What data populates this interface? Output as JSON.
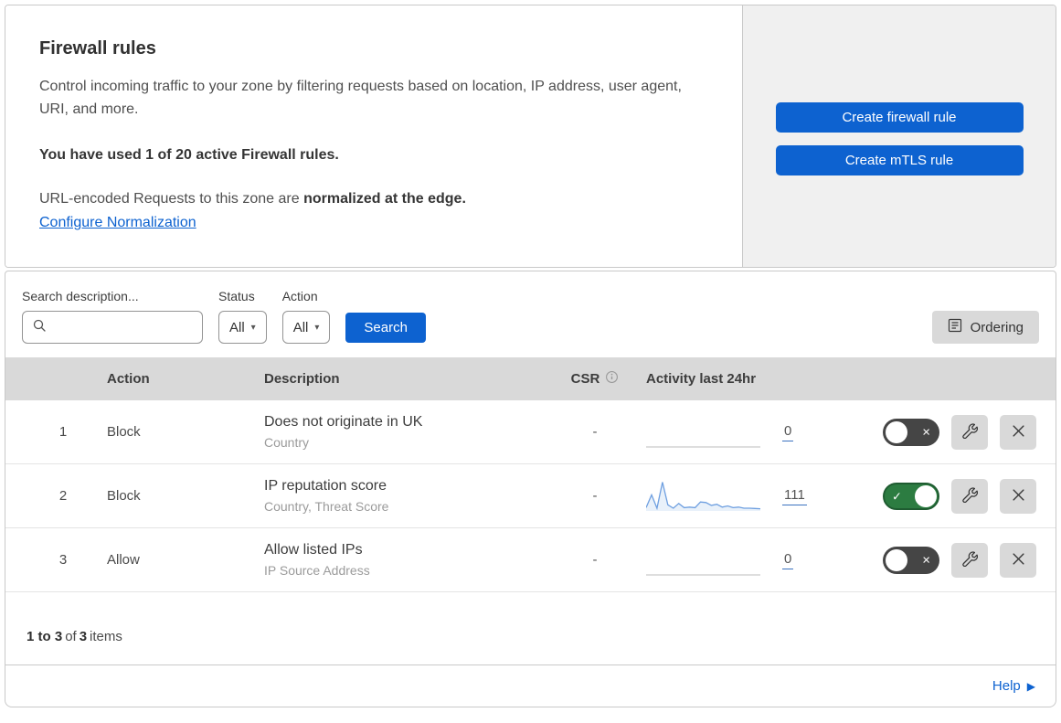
{
  "intro": {
    "title": "Firewall rules",
    "description": "Control incoming traffic to your zone by filtering requests based on location, IP address, user agent, URI, and more.",
    "usage_note": "You have used 1 of 20 active Firewall rules.",
    "normalization_prefix": "URL-encoded Requests to this zone are",
    "normalization_emphasis": "normalized at the edge.",
    "normalization_link": "Configure Normalization"
  },
  "actions": {
    "create_firewall_rule": "Create firewall rule",
    "create_mtls_rule": "Create mTLS rule"
  },
  "filters": {
    "search_label": "Search description...",
    "status_label": "Status",
    "status_selected": "All",
    "action_label": "Action",
    "action_selected": "All",
    "search_button": "Search",
    "ordering_button": "Ordering"
  },
  "table": {
    "headers": {
      "action": "Action",
      "description": "Description",
      "csr": "CSR",
      "activity": "Activity last 24hr"
    },
    "rows": [
      {
        "priority": "1",
        "action": "Block",
        "description": "Does not originate in UK",
        "criteria": "Country",
        "csr": "-",
        "activity_count": "0",
        "enabled": false,
        "sparkline": [
          0,
          0,
          0,
          0,
          0,
          0,
          0,
          0,
          0,
          0,
          0,
          0,
          0,
          0,
          0,
          0,
          0,
          0,
          0,
          0,
          0,
          0
        ]
      },
      {
        "priority": "2",
        "action": "Block",
        "description": "IP reputation score",
        "criteria": "Country, Threat Score",
        "csr": "-",
        "activity_count": "111",
        "enabled": true,
        "sparkline": [
          10,
          55,
          8,
          100,
          20,
          8,
          25,
          10,
          12,
          10,
          30,
          28,
          18,
          22,
          12,
          16,
          10,
          12,
          8,
          8,
          7,
          6
        ]
      },
      {
        "priority": "3",
        "action": "Allow",
        "description": "Allow listed IPs",
        "criteria": "IP Source Address",
        "csr": "-",
        "activity_count": "0",
        "enabled": false,
        "sparkline": [
          0,
          0,
          0,
          0,
          0,
          0,
          0,
          0,
          0,
          0,
          0,
          0,
          0,
          0,
          0,
          0,
          0,
          0,
          0,
          0,
          0,
          0
        ]
      }
    ]
  },
  "pagination": {
    "range": "1 to 3",
    "of": "of",
    "total": "3",
    "items": "items"
  },
  "footer": {
    "help": "Help"
  },
  "colors": {
    "accent_blue": "#0d62d0",
    "toggle_on_green": "#2c7c41",
    "toggle_off_gray": "#454545",
    "sparkline_blue": "#6e9fe0",
    "sparkline_fill": "rgba(110,159,224,0.15)",
    "sparkline_empty": "#c9c9c9",
    "panel_gray": "#f0f0f0",
    "table_header_gray": "#d9d9d9"
  }
}
